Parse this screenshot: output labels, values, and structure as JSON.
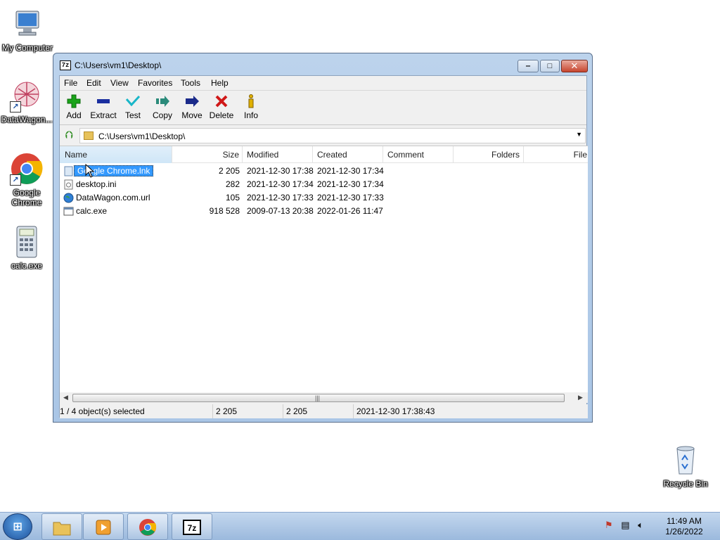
{
  "desktop": {
    "icons": [
      {
        "label": "My Computer"
      },
      {
        "label": "DataWagon..."
      },
      {
        "label": "Google Chrome"
      },
      {
        "label": "calc.exe"
      },
      {
        "label": "Recycle Bin"
      }
    ]
  },
  "window": {
    "app_icon": "7z",
    "title": "C:\\Users\\vm1\\Desktop\\",
    "controls": {
      "minimize": "‒",
      "maximize": "□",
      "close": "✕"
    }
  },
  "menu": [
    "File",
    "Edit",
    "View",
    "Favorites",
    "Tools",
    "Help"
  ],
  "toolbar": [
    {
      "label": "Add",
      "icon": "plus-icon",
      "color": "#1aa31a"
    },
    {
      "label": "Extract",
      "icon": "minus-icon",
      "color": "#1a2fa0"
    },
    {
      "label": "Test",
      "icon": "check-icon",
      "color": "#18b6c8"
    },
    {
      "label": "Copy",
      "icon": "copy-arrow-icon",
      "color": "#2a8a7a"
    },
    {
      "label": "Move",
      "icon": "move-arrow-icon",
      "color": "#1a2a8a"
    },
    {
      "label": "Delete",
      "icon": "delete-x-icon",
      "color": "#d01818"
    },
    {
      "label": "Info",
      "icon": "info-icon",
      "color": "#e0b000"
    }
  ],
  "address": {
    "path": "C:\\Users\\vm1\\Desktop\\"
  },
  "columns": [
    "Name",
    "Size",
    "Modified",
    "Created",
    "Comment",
    "Folders",
    "File"
  ],
  "files": [
    {
      "name": "Google Chrome.lnk",
      "size": "2 205",
      "modified": "2021-12-30 17:38",
      "created": "2021-12-30 17:34",
      "icon": "shortcut-file-icon",
      "selected": true
    },
    {
      "name": "desktop.ini",
      "size": "282",
      "modified": "2021-12-30 17:34",
      "created": "2021-12-30 17:34",
      "icon": "ini-file-icon",
      "selected": false
    },
    {
      "name": "DataWagon.com.url",
      "size": "105",
      "modified": "2021-12-30 17:33",
      "created": "2021-12-30 17:33",
      "icon": "globe-icon",
      "selected": false
    },
    {
      "name": "calc.exe",
      "size": "918 528",
      "modified": "2009-07-13 20:38",
      "created": "2022-01-26 11:47",
      "icon": "exe-file-icon",
      "selected": false
    }
  ],
  "status": {
    "selection": "1 / 4 object(s) selected",
    "size": "2 205",
    "packed": "2 205",
    "modified": "2021-12-30 17:38:43"
  },
  "taskbar": {
    "time": "11:49 AM",
    "date": "1/26/2022"
  }
}
